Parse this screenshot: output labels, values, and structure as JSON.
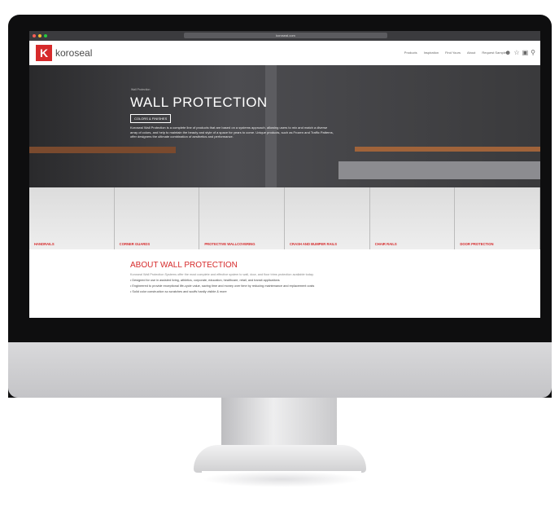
{
  "browser": {
    "url": "koroseal.com"
  },
  "nav": {
    "logo_letter": "K",
    "brand": "koroseal",
    "links": [
      "Products",
      "Inspiration",
      "Find Yours",
      "About",
      "Request Samples"
    ]
  },
  "hero": {
    "breadcrumb": "Wall Protection",
    "title": "WALL PROTECTION",
    "button": "COLORS & FINISHES",
    "description": "Koroseal Wall Protection is a complete line of products that are based on a systems approach, allowing users to mix and match a diverse array of colors, and help to maintain the beauty and style of a space for years to come. Unique products, such as Frozen and Traffic Patterns, offer designers the ultimate combination of aesthetics and performance."
  },
  "categories": [
    "HANDRAILS",
    "CORNER GUARDS",
    "PROTECTIVE WALLCOVERING",
    "CRASH AND BUMPER RAILS",
    "CHAIR RAILS",
    "DOOR PROTECTION"
  ],
  "about": {
    "heading": "ABOUT WALL PROTECTION",
    "intro": "Koroseal Wall Protection Systems offer the most complete and effective system to wall, door, and floor trims protection available today.",
    "bullets": [
      "Designed for use in assisted living, athletics, corporate, education, healthcare, retail, and transit applications",
      "Engineered to provide exceptional life-cycle value, saving time and money over time by reducing maintenance and replacement costs",
      "Solid color construction so scratches and scuffs hardly visible & more"
    ]
  }
}
